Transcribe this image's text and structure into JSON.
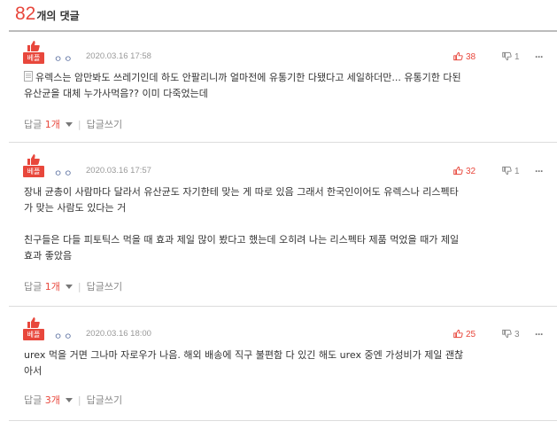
{
  "header": {
    "count": "82",
    "label": "개의 댓글"
  },
  "comments": [
    {
      "badge": "베플",
      "user": "ㅇㅇ",
      "date": "2020.03.16 17:58",
      "up": "38",
      "down": "1",
      "more": "···",
      "lines": [
        "유렉스는 암만봐도 쓰레기인데 하도 안팔리니까 얼마전에 유통기한 다됐다고 세일하더만... 유통기한 다된",
        "유산균을 대체 누가사먹음?? 이미 다죽었는데"
      ],
      "reply_label": "답글",
      "reply_count": "1개",
      "write_label": "답글쓰기"
    },
    {
      "badge": "베플",
      "user": "ㅇㅇ",
      "date": "2020.03.16 17:57",
      "up": "32",
      "down": "1",
      "more": "···",
      "lines": [
        "장내 균총이 사람마다 달라서 유산균도 자기한테 맞는 게 따로 있음 그래서 한국인이어도 유렉스나 리스펙타",
        "가 맞는 사람도 있다는 거",
        "친구들은 다들 피토틱스 먹을 때 효과 제일 많이 봤다고 했는데 오히려 나는 리스펙타 제품 먹었을 때가 제일",
        "효과 좋았음"
      ],
      "reply_label": "답글",
      "reply_count": "1개",
      "write_label": "답글쓰기"
    },
    {
      "badge": "베플",
      "user": "ㅇㅇ",
      "date": "2020.03.16 18:00",
      "up": "25",
      "down": "3",
      "more": "···",
      "lines": [
        "urex 먹을 거면 그나마 자로우가 나음. 해외 배송에 직구 불편함 다 있긴 해도 urex 중엔 가성비가 제일 괜찮",
        "아서"
      ],
      "reply_label": "답글",
      "reply_count": "3개",
      "write_label": "답글쓰기"
    }
  ]
}
